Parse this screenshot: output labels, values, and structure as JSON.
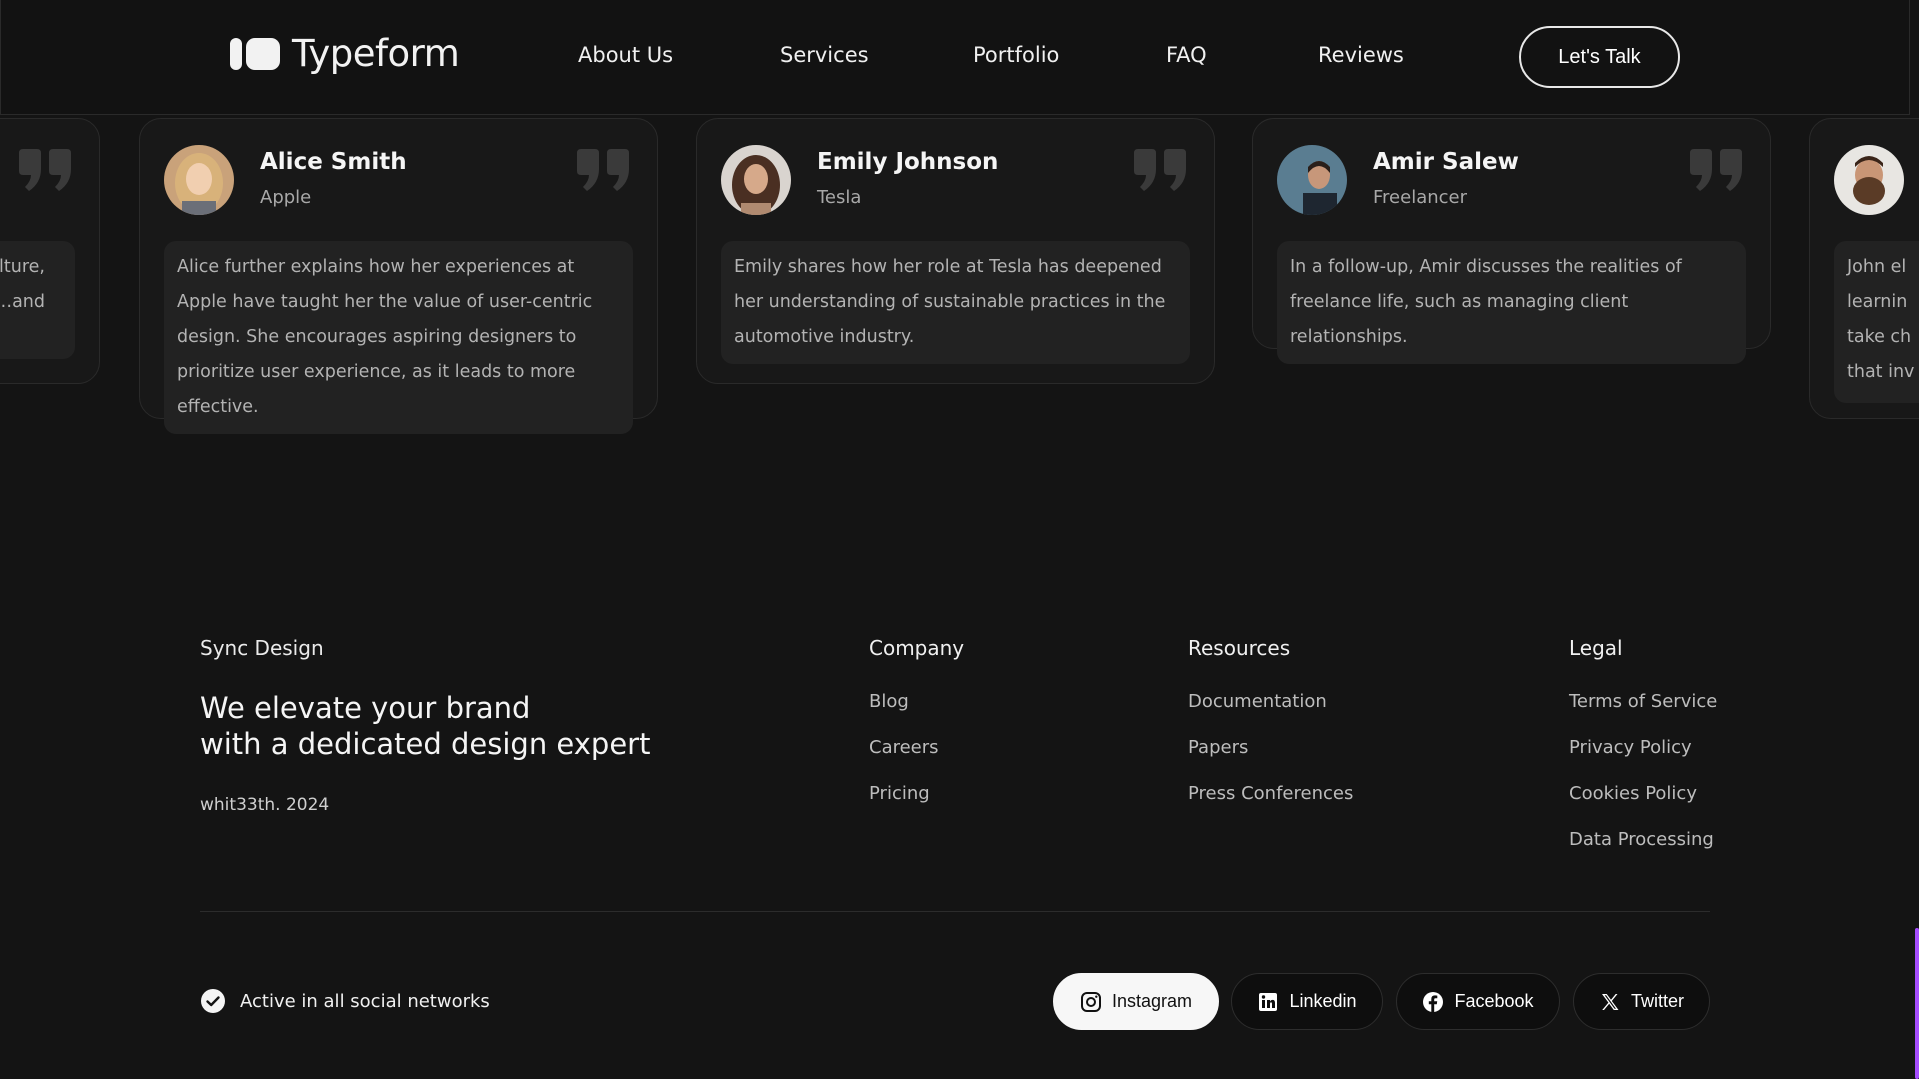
{
  "header": {
    "brand": "Typeform",
    "nav": [
      "About Us",
      "Services",
      "Portfolio",
      "FAQ",
      "Reviews"
    ],
    "cta_label": "Let's Talk"
  },
  "testimonials": [
    {
      "name": "",
      "company": "",
      "text": "…ulture,\n…and"
    },
    {
      "name": "Alice Smith",
      "company": "Apple",
      "text": "Alice further explains how her experiences at Apple have taught her the value of user-centric design. She encourages aspiring designers to prioritize user experience, as it leads to more effective."
    },
    {
      "name": "Emily Johnson",
      "company": "Tesla",
      "text": "Emily shares how her role at Tesla has deepened her understanding of sustainable practices in the automotive industry."
    },
    {
      "name": "Amir Salew",
      "company": "Freelancer",
      "text": "In a follow-up, Amir discusses the realities of freelance life, such as managing client relationships."
    },
    {
      "name": "",
      "company": "",
      "text": "John el\nlearnin\ntake ch\nthat inv"
    }
  ],
  "footer": {
    "brand": "Sync Design",
    "tagline_line1": "We elevate your brand",
    "tagline_line2": "with a dedicated design expert",
    "copyright": "whit33th. 2024",
    "columns": [
      {
        "title": "Company",
        "links": [
          "Blog",
          "Careers",
          "Pricing"
        ]
      },
      {
        "title": "Resources",
        "links": [
          "Documentation",
          "Papers",
          "Press Conferences"
        ]
      },
      {
        "title": "Legal",
        "links": [
          "Terms of Service",
          "Privacy Policy",
          "Cookies Policy",
          "Data Processing"
        ]
      }
    ],
    "status_text": "Active in all social networks",
    "social": [
      "Instagram",
      "Linkedin",
      "Facebook",
      "Twitter"
    ]
  },
  "colors": {
    "background": "#141414",
    "card": "#181818",
    "card_body": "#222222",
    "accent": "#a64dff"
  }
}
